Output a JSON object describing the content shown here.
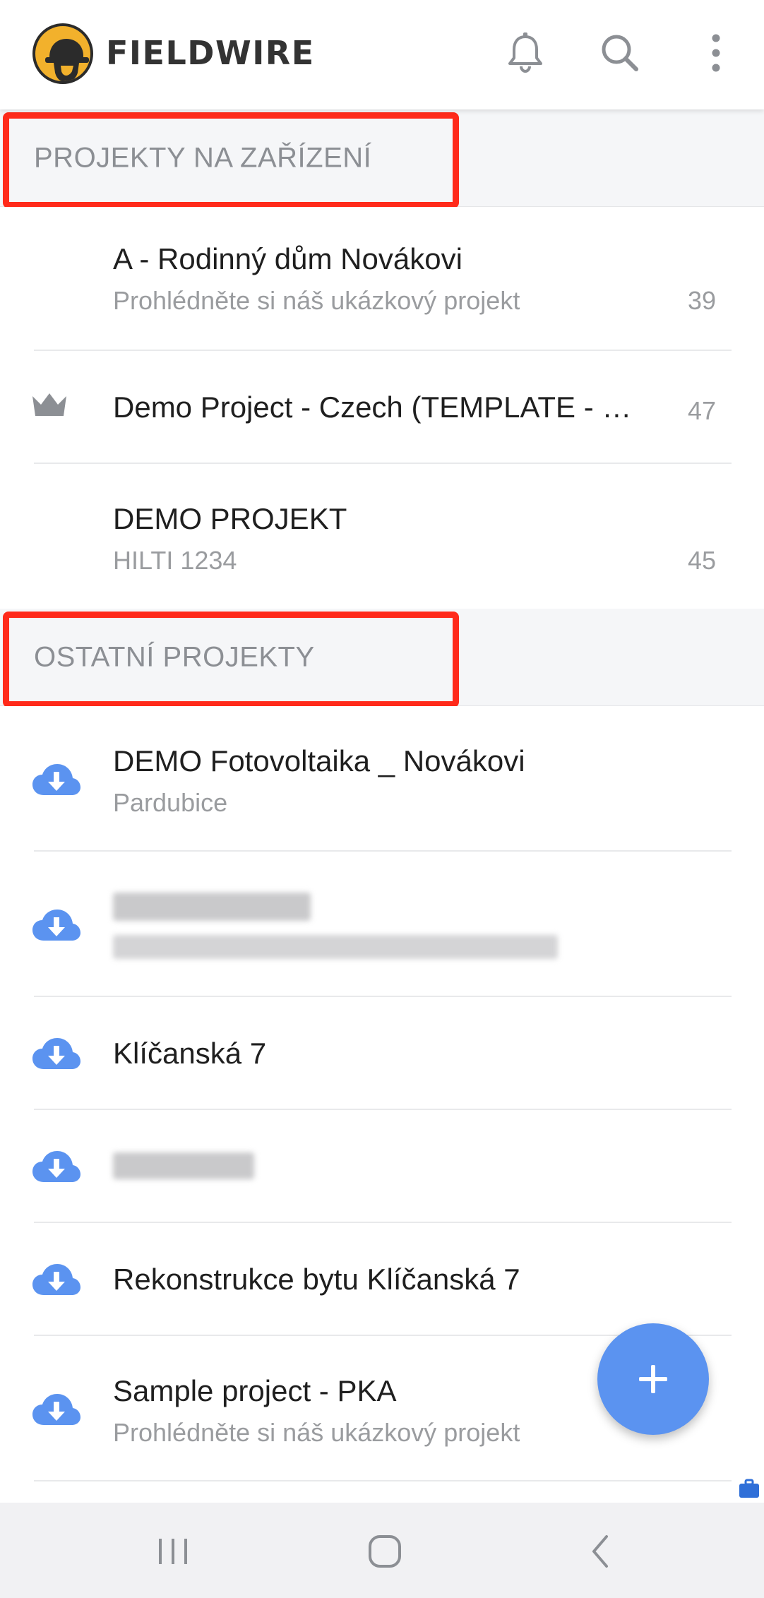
{
  "app": {
    "brand": "FIELDWIRE",
    "accent_color": "#5b93f0",
    "highlight_color": "#ff2a1a"
  },
  "header_icons": [
    "bell-icon",
    "search-icon",
    "more-vert-icon"
  ],
  "sections": {
    "device": {
      "title": "PROJEKTY NA ZAŘÍZENÍ",
      "items": [
        {
          "title": "A - Rodinný dům Novákovi",
          "subtitle": "Prohlédněte si náš ukázkový projekt",
          "count": "39",
          "icon": ""
        },
        {
          "title": "Demo Project - Czech (TEMPLATE - …",
          "subtitle": "",
          "count": "47",
          "icon": "crown-icon"
        },
        {
          "title": "DEMO PROJEKT",
          "subtitle": "HILTI 1234",
          "count": "45",
          "icon": ""
        }
      ]
    },
    "other": {
      "title": "OSTATNÍ PROJEKTY",
      "items": [
        {
          "title": "DEMO Fotovoltaika _ Novákovi",
          "subtitle": "Pardubice",
          "icon": "cloud-download-icon"
        },
        {
          "title": "",
          "subtitle": "",
          "icon": "cloud-download-icon",
          "blurred": true
        },
        {
          "title": "Klíčanská 7",
          "subtitle": "",
          "icon": "cloud-download-icon"
        },
        {
          "title": "",
          "subtitle": "",
          "icon": "cloud-download-icon",
          "blurred": true
        },
        {
          "title": "Rekonstrukce bytu Klíčanská 7",
          "subtitle": "",
          "icon": "cloud-download-icon"
        },
        {
          "title": "Sample project - PKA",
          "subtitle": "Prohlédněte si náš ukázkový projekt",
          "icon": "cloud-download-icon"
        }
      ]
    }
  },
  "fab": {
    "icon": "plus-icon"
  },
  "system_nav": [
    "recents-icon",
    "home-icon",
    "back-icon"
  ]
}
